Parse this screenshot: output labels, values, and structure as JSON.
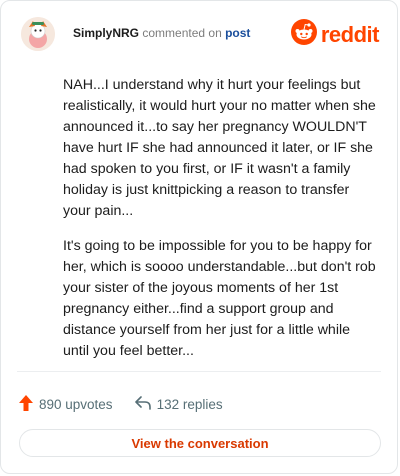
{
  "header": {
    "username": "SimplyNRG",
    "action": "commented on",
    "link": "post",
    "logo_text": "reddit"
  },
  "comment": {
    "paragraphs": [
      "NAH...I understand why it hurt your feelings but realistically, it would hurt your no matter when she announced it...to say her pregnancy WOULDN'T have hurt IF she had announced it later, or IF she had spoken to you first, or IF it wasn't a family holiday is just knittpicking a reason to transfer your pain...",
      "It's going to be impossible for you to be happy for her, which is soooo understandable...but don't rob your sister of the joyous moments of her 1st pregnancy either...find a support group and distance yourself from her just for a little while until you feel better..."
    ]
  },
  "stats": {
    "upvotes": "890 upvotes",
    "replies": "132 replies"
  },
  "cta": {
    "label": "View the conversation"
  },
  "colors": {
    "brand": "#ff4500",
    "link": "#1a4e9c",
    "cta_text": "#d93900",
    "muted": "#576f76"
  },
  "icons": [
    "avatar",
    "reddit-logo-icon",
    "upvote-arrow-icon",
    "reply-arrow-icon"
  ]
}
